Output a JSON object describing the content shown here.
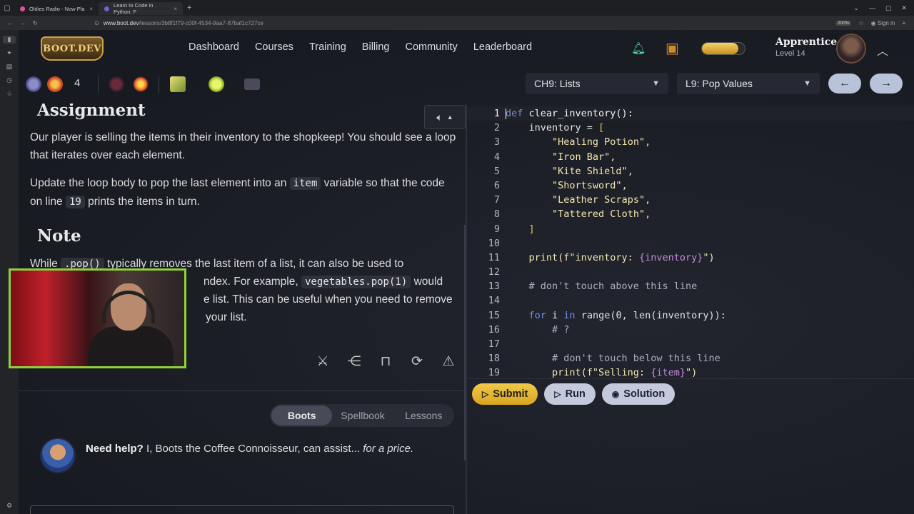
{
  "browser": {
    "tabs": [
      {
        "title": "Oldies Radio - Now Pla",
        "active": false
      },
      {
        "title": "Learn to Code in Python: F",
        "active": true
      }
    ],
    "url_domain": "www.boot.dev",
    "url_path": "/lessons/3b8f1f79-c00f-4534-9aa7-87baf1c727ce",
    "zoom": "200%",
    "sign_in": "Sign in"
  },
  "app": {
    "logo": "BOOT.DEV",
    "nav": [
      "Dashboard",
      "Courses",
      "Training",
      "Billing",
      "Community",
      "Leaderboard"
    ],
    "user": {
      "rank": "Apprentice",
      "level": "Level 14",
      "xp_fraction": 0.85
    },
    "streak_count": "4",
    "chapter_select": "CH9: Lists",
    "lesson_select": "L9: Pop Values"
  },
  "lesson": {
    "assignment_heading": "Assignment",
    "p1": "Our player is selling the items in their inventory to the shopkeep! You should see a loop that iterates over each element.",
    "p2_a": "Update the loop body to pop the last element into an ",
    "p2_code1": "item",
    "p2_b": " variable so that the code on line ",
    "p2_code2": "19",
    "p2_c": " prints the items in turn.",
    "note_heading": "Note",
    "n1_a": "While ",
    "n1_code1": ".pop()",
    "n1_b": " typically removes the last item of a list, it can also be used to",
    "n2_a": "ndex. For example, ",
    "n2_code": "vegetables.pop(1)",
    "n2_b": " would",
    "n3": "e list. This can be useful when you need to remove",
    "n4": "your list."
  },
  "tabs_seg": [
    "Boots",
    "Spellbook",
    "Lessons"
  ],
  "help": {
    "bold": "Need help?",
    "text": " I, Boots the Coffee Connoisseur, can assist... ",
    "italic": "for a price."
  },
  "editor": {
    "line_numbers": [
      "1",
      "2",
      "3",
      "4",
      "5",
      "6",
      "7",
      "8",
      "9",
      "10",
      "11",
      "12",
      "13",
      "14",
      "15",
      "16",
      "17",
      "18",
      "19"
    ],
    "code": {
      "l1_kw": "def",
      "l1_rest": " clear_inventory():",
      "l2": "    inventory = ",
      "l2_br": "[",
      "items": [
        "\"Healing Potion\",",
        "\"Iron Bar\",",
        "\"Kite Shield\",",
        "\"Shortsword\",",
        "\"Leather Scraps\",",
        "\"Tattered Cloth\","
      ],
      "l9_br": "]",
      "l11_a": "    print(f\"inventory: ",
      "l11_b": "{inventory}",
      "l11_c": "\")",
      "l13": "    # don't touch above this line",
      "l15_for": "for",
      "l15_in": "in",
      "l15_a": " i ",
      "l15_b": " range(0, len(inventory)):",
      "l16": "        # ?",
      "l18": "        # don't touch below this line",
      "l19_a": "        print(f\"Selling: ",
      "l19_b": "{item}",
      "l19_c": "\")"
    }
  },
  "buttons": {
    "submit": "Submit",
    "run": "Run",
    "solution": "Solution"
  }
}
